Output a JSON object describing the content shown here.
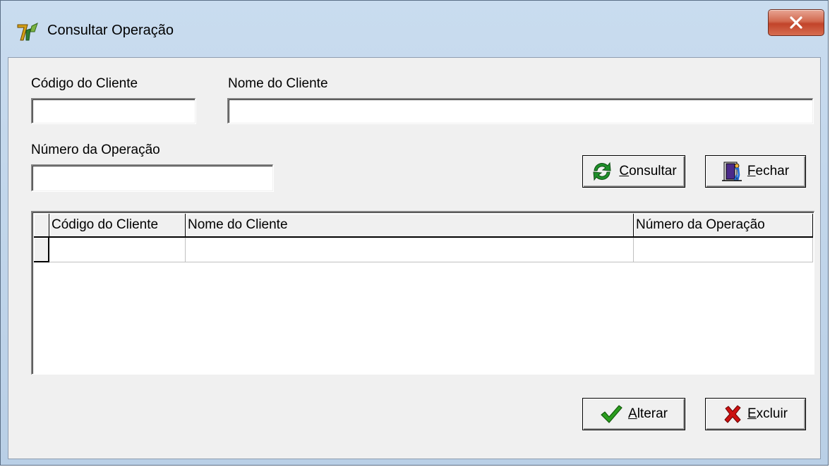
{
  "window": {
    "title": "Consultar Operação",
    "close_label": "X"
  },
  "form": {
    "codigo_label": "Código do Cliente",
    "codigo_value": "",
    "nome_label": "Nome do Cliente",
    "nome_value": "",
    "numero_label": "Número da Operação",
    "numero_value": ""
  },
  "buttons": {
    "consultar_first": "C",
    "consultar_rest": "onsultar",
    "fechar_first": "F",
    "fechar_rest": "echar",
    "alterar_first": "A",
    "alterar_rest": "lterar",
    "excluir_first": "E",
    "excluir_rest": "xcluir"
  },
  "grid": {
    "columns": [
      "Código do Cliente",
      "Nome do Cliente",
      "Número da Operação"
    ],
    "rows": [
      [
        "",
        "",
        ""
      ]
    ]
  },
  "icons": {
    "app": "app-logo-icon",
    "consultar": "refresh-icon",
    "fechar": "exit-door-icon",
    "alterar": "checkmark-icon",
    "excluir": "red-x-icon"
  },
  "colors": {
    "close_button": "#c2442a",
    "refresh_green": "#1f8f2a",
    "check_green": "#2a9d1e",
    "delete_red": "#cc1111"
  }
}
